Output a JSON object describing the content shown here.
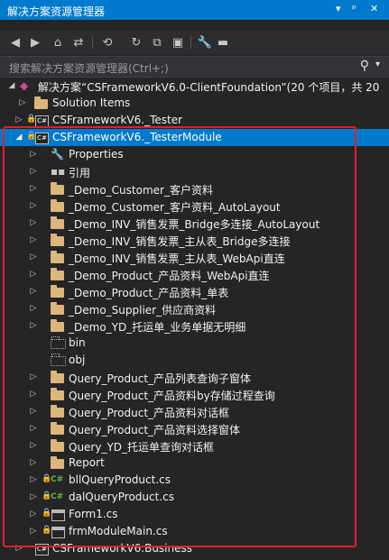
{
  "window": {
    "title": "解决方案资源管理器",
    "buttons": [
      "▾",
      "ᵖ",
      "✕"
    ]
  },
  "search": {
    "placeholder": "搜索解决方案资源管理器(Ctrl+;)"
  },
  "tree": {
    "solution": "解决方案“CSFrameworkV6.0-ClientFoundation”(20 个项目，共 20",
    "items": [
      "Solution Items",
      "CSFrameworkV6._Tester",
      "CSFrameworkV6._TesterModule",
      "Properties",
      "引用",
      "_Demo_Customer_客户资料",
      "_Demo_Customer_客户资料_AutoLayout",
      "_Demo_INV_销售发票_Bridge多连接_AutoLayout",
      "_Demo_INV_销售发票_主从表_Bridge多连接",
      "_Demo_INV_销售发票_主从表_WebApi直连",
      "_Demo_Product_产品资料_WebApi直连",
      "_Demo_Product_产品资料_单表",
      "_Demo_Supplier_供应商资料",
      "_Demo_YD_托运单_业务单据无明细",
      "bin",
      "obj",
      "Query_Product_产品列表查询子窗体",
      "Query_Product_产品资料by存储过程查询",
      "Query_Product_产品资料对话框",
      "Query_Product_产品资料选择窗体",
      "Query_YD_托运单查询对话框",
      "Report",
      "bllQueryProduct.cs",
      "dalQueryProduct.cs",
      "Form1.cs",
      "frmModuleMain.cs",
      "CSFrameworkV6.Business"
    ]
  },
  "colors": {
    "accent": "#007acc",
    "highlight": "#e0202a",
    "folder": "#dcb67a"
  }
}
